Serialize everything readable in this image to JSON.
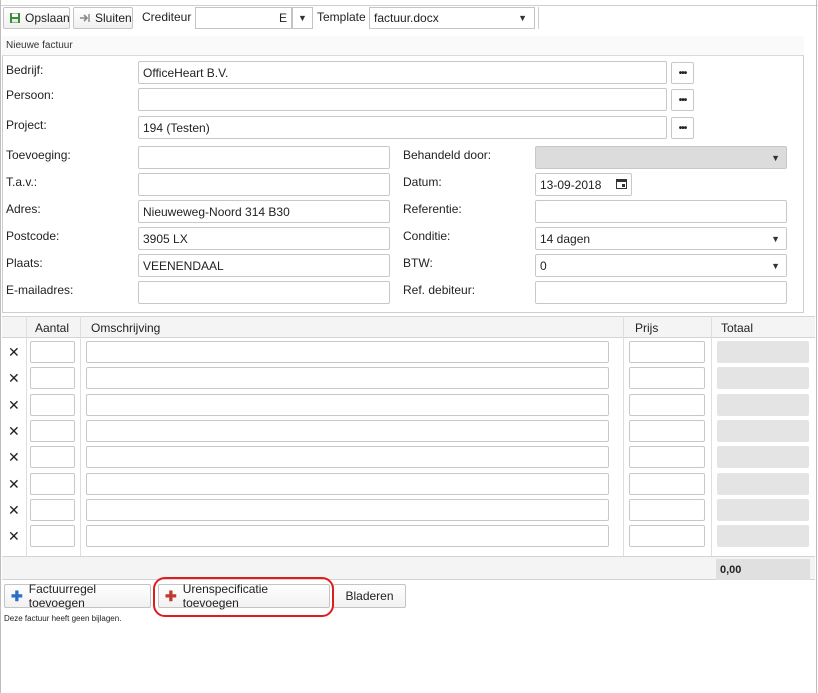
{
  "toolbar": {
    "save_label": "Opslaan",
    "close_label": "Sluiten",
    "crediteur_label": "Crediteur",
    "crediteur_value": "",
    "crediteur_code": "E",
    "template_label": "Template",
    "template_value": "factuur.docx"
  },
  "panel": {
    "title": "Nieuwe factuur"
  },
  "form": {
    "bedrijf": {
      "label": "Bedrijf:",
      "value": "OfficeHeart B.V."
    },
    "persoon": {
      "label": "Persoon:",
      "value": ""
    },
    "project": {
      "label": "Project:",
      "value": "194 (Testen)"
    },
    "toevoeging": {
      "label": "Toevoeging:",
      "value": ""
    },
    "tav": {
      "label": "T.a.v.:",
      "value": ""
    },
    "adres": {
      "label": "Adres:",
      "value": "Nieuweweg-Noord 314 B30"
    },
    "postcode": {
      "label": "Postcode:",
      "value": "3905 LX"
    },
    "plaats": {
      "label": "Plaats:",
      "value": "VEENENDAAL"
    },
    "email": {
      "label": "E-mailadres:",
      "value": ""
    },
    "behandeld": {
      "label": "Behandeld door:",
      "value": ""
    },
    "datum": {
      "label": "Datum:",
      "value": "13-09-2018"
    },
    "referentie": {
      "label": "Referentie:",
      "value": ""
    },
    "conditie": {
      "label": "Conditie:",
      "value": "14 dagen"
    },
    "btw": {
      "label": "BTW:",
      "value": "0"
    },
    "ref_debiteur": {
      "label": "Ref. debiteur:",
      "value": ""
    }
  },
  "table": {
    "headers": {
      "aantal": "Aantal",
      "omschrijving": "Omschrijving",
      "prijs": "Prijs",
      "totaal": "Totaal"
    },
    "rows": 8,
    "remove_symbol": "✕",
    "grand_total": "0,00"
  },
  "actions": {
    "add_line": "Factuurregel toevoegen",
    "add_hours": "Urenspecificatie toevoegen",
    "browse": "Bladeren"
  },
  "attachments_note": "Deze factuur heeft geen bijlagen.",
  "colors": {
    "highlight": "#e01b1b",
    "plus_blue": "#2b6fc7",
    "plus_red": "#c0392b"
  }
}
